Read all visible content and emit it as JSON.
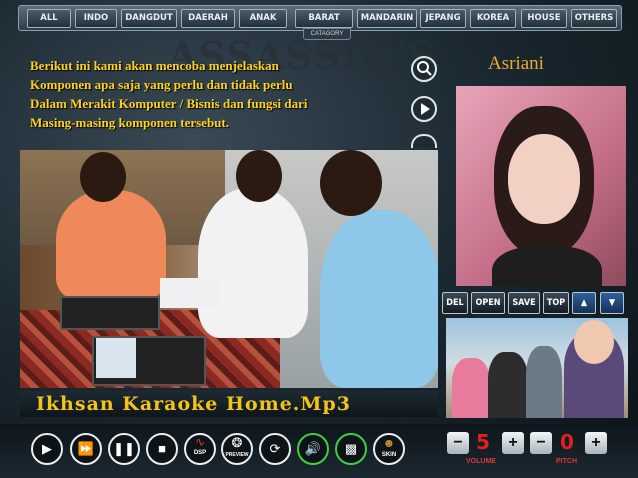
{
  "categories": [
    "ALL",
    "INDO",
    "DANGDUT",
    "DAERAH",
    "ANAK",
    "BARAT",
    "MANDARIN",
    "JEPANG",
    "KOREA",
    "HOUSE",
    "OTHERS"
  ],
  "category_tag": "CATAGORY",
  "logo_text": "ASSASSIN'S",
  "info_lines": [
    "Berikut ini kami akan mencoba menjelaskan",
    "Komponen apa saja yang perlu dan tidak perlu",
    "Dalam Merakit Komputer / Bisnis dan fungsi dari",
    "Masing-masing komponen tersebut."
  ],
  "song_title": "Ikhsan Karaoke Home.Mp3",
  "singer_name": "Asriani",
  "queue_buttons": {
    "del": "DEL",
    "open": "OPEN",
    "save": "SAVE",
    "top": "TOP"
  },
  "controls": {
    "dsp": "DSP",
    "preview": "PREVIEW",
    "skin": "SKIN"
  },
  "volume": {
    "value": "5",
    "label": "VOLUME"
  },
  "pitch": {
    "value": "0",
    "label": "PITCH"
  },
  "colors": {
    "accent_yellow": "#ffd21f",
    "volume_red": "#e11f1f",
    "green_ring": "#3fd03f"
  }
}
